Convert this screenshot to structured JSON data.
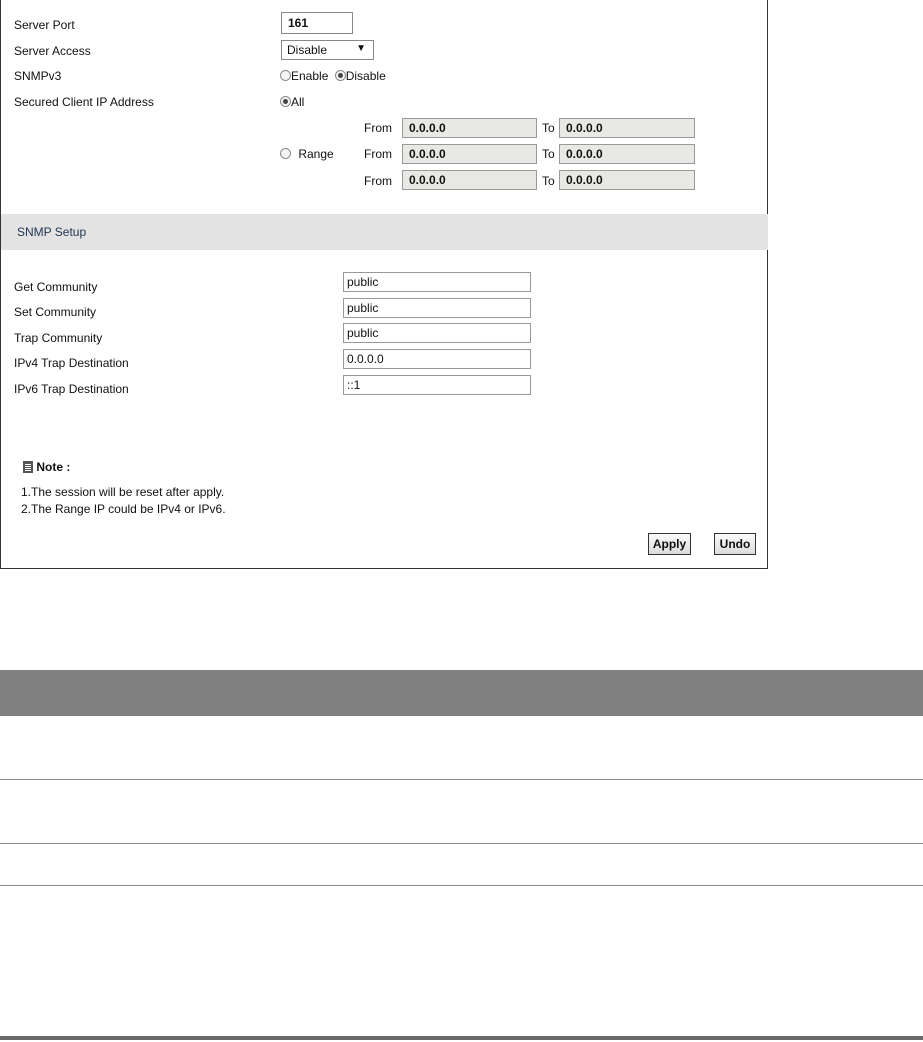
{
  "server": {
    "port_label": "Server Port",
    "port_value": "161",
    "access_label": "Server Access",
    "access_value": "Disable",
    "snmpv3_label": "SNMPv3",
    "snmpv3_enable": "Enable",
    "snmpv3_disable": "Disable",
    "snmpv3_selected": "Disable",
    "secured_label": "Secured Client IP Address",
    "secured_all": "All",
    "secured_range": "Range",
    "secured_selected": "All"
  },
  "range": {
    "from_label": "From",
    "to_label": "To",
    "rows": [
      {
        "from": "0.0.0.0",
        "to": "0.0.0.0"
      },
      {
        "from": "0.0.0.0",
        "to": "0.0.0.0"
      },
      {
        "from": "0.0.0.0",
        "to": "0.0.0.0"
      }
    ]
  },
  "snmp_setup": {
    "title": "SNMP Setup",
    "fields": [
      {
        "label": "Get Community",
        "value": "public"
      },
      {
        "label": "Set Community",
        "value": "public"
      },
      {
        "label": "Trap Community",
        "value": "public"
      },
      {
        "label": "IPv4 Trap Destination",
        "value": "0.0.0.0"
      },
      {
        "label": "IPv6 Trap Destination",
        "value": "::1"
      }
    ]
  },
  "note": {
    "title": "Note :",
    "lines": [
      "1.The session will be reset after apply.",
      "2.The Range IP could be IPv4 or IPv6."
    ]
  },
  "buttons": {
    "apply": "Apply",
    "undo": "Undo"
  }
}
